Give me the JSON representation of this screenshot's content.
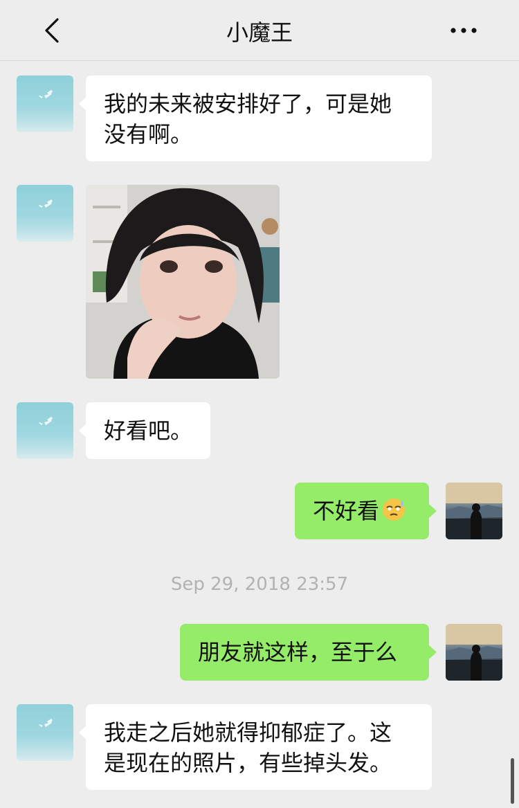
{
  "header": {
    "title": "小魔王",
    "back_icon": "chevron-left-icon",
    "more_icon": "more-horizontal-icon"
  },
  "messages": [
    {
      "side": "left",
      "text": "我的未来被安排好了，可是她没有啊。",
      "lines": [
        "我的未来被安排好了，可是她",
        "没有啊。"
      ]
    },
    {
      "side": "left",
      "type": "image",
      "content": "selfie-photo"
    },
    {
      "side": "left",
      "text": "好看吧。"
    },
    {
      "side": "right",
      "text": "不好看",
      "emoji": "sweat-emoji"
    },
    {
      "side": "right",
      "text": "朋友就这样，至于么"
    },
    {
      "side": "left",
      "text": "我走之后她就得抑郁症了。这是现在的照片，有些掉头发。",
      "lines": [
        "我走之后她就得抑郁症了。这",
        "是现在的照片，有些掉头发。"
      ]
    }
  ],
  "timestamp": "Sep 29, 2018 23:57",
  "colors": {
    "background": "#ededed",
    "bubble_left": "#ffffff",
    "bubble_right": "#95ec69",
    "timestamp_text": "#b2b2b2"
  }
}
